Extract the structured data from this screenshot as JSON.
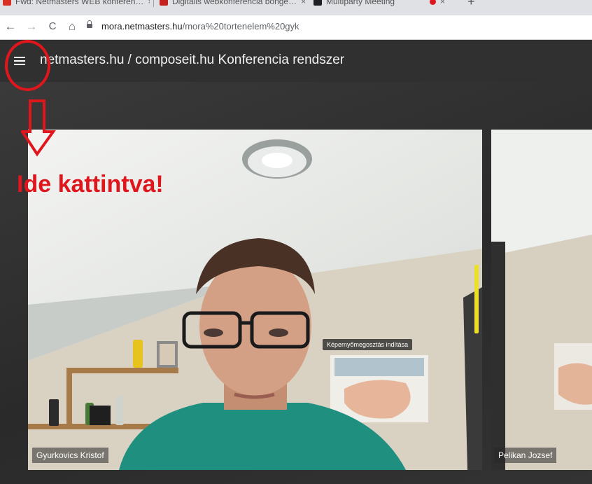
{
  "browser": {
    "tabs": [
      {
        "label": "Fwd: Netmasters WEB konferen…",
        "favicon_color": "#d93025"
      },
      {
        "label": "Digitális webkonferencia böngé…",
        "favicon_color": "#c5221f"
      },
      {
        "label": "Multiparty Meeting",
        "favicon_color": "#202124"
      }
    ],
    "new_tab": "+",
    "close_glyph": "×",
    "back_glyph": "←",
    "forward_glyph": "→",
    "reload_glyph": "C",
    "home_glyph": "⌂",
    "url_host": "mora.netmasters.hu",
    "url_path": "/mora%20tortenelem%20gyk"
  },
  "app": {
    "title": "netmasters.hu / composeit.hu Konferencia rendszer",
    "menu_icon": "hamburger-menu-icon"
  },
  "videos": [
    {
      "participant": "Gyurkovics Kristof"
    },
    {
      "participant": "Pelikan Jozsef"
    }
  ],
  "tooltip": "Képernyőmegosztás indítása",
  "annotation": {
    "text": "Ide kattintva!",
    "color": "#e0161d"
  },
  "colors": {
    "appbar": "#303030",
    "annotation_red": "#e0161d",
    "indicator_yellow": "#ecdf2a"
  }
}
